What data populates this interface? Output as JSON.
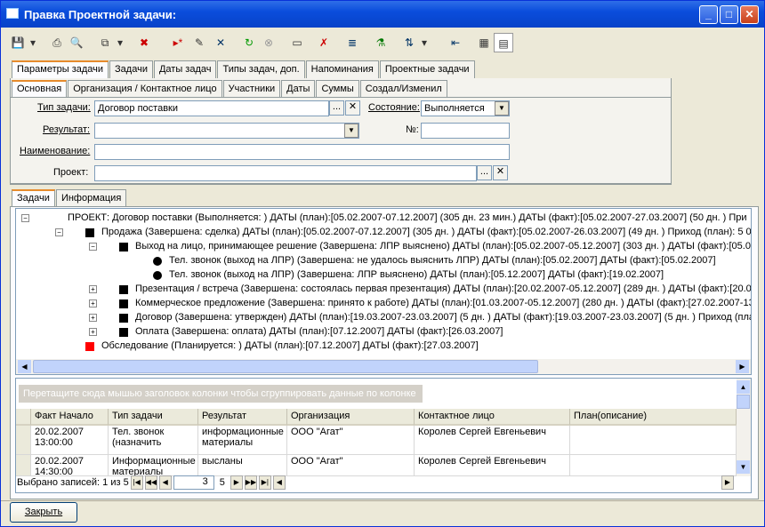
{
  "window": {
    "title": "Правка Проектной задачи:"
  },
  "top_tabs": [
    "Параметры задачи",
    "Задачи",
    "Даты задач",
    "Типы задач, доп.",
    "Напоминания",
    "Проектные задачи"
  ],
  "sub_tabs": [
    "Основная",
    "Организация / Контактное лицо",
    "Участники",
    "Даты",
    "Суммы",
    "Создал/Изменил"
  ],
  "form": {
    "task_type_label": "Тип задачи:",
    "task_type_value": "Договор поставки",
    "state_label": "Состояние:",
    "state_value": "Выполняется",
    "result_label": "Результат:",
    "result_value": "",
    "number_label": "№:",
    "number_value": "",
    "name_label": "Наименование:",
    "name_value": "",
    "project_label": "Проект:",
    "project_value": ""
  },
  "lower_tabs": [
    "Задачи",
    "Информация"
  ],
  "tree": [
    "ПРОЕКТ: Договор поставки (Выполняется: ) ДАТЫ (план):[05.02.2007-07.12.2007] (305 дн. 23 мин.)  ДАТЫ (факт):[05.02.2007-27.03.2007] (50 дн. )   При",
    "Продажа (Завершена: сделка) ДАТЫ (план):[05.02.2007-07.12.2007] (305 дн. )  ДАТЫ (факт):[05.02.2007-26.03.2007] (49 дн. )   Приход (план): 5 0",
    "Выход на лицо, принимающее решение (Завершена: ЛПР выяснено) ДАТЫ (план):[05.02.2007-05.12.2007] (303 дн. )  ДАТЫ (факт):[05.02",
    "Тел. звонок (выход на ЛПР) (Завершена: не удалось выяснить ЛПР) ДАТЫ (план):[05.02.2007] ДАТЫ (факт):[05.02.2007]",
    "Тел. звонок (выход на ЛПР) (Завершена: ЛПР выяснено) ДАТЫ (план):[05.12.2007] ДАТЫ (факт):[19.02.2007]",
    "Презентация / встреча (Завершена: состоялась первая презентация) ДАТЫ (план):[20.02.2007-05.12.2007] (289 дн. )  ДАТЫ (факт):[20.0",
    "Коммерческое предложение (Завершена: принято к работе) ДАТЫ (план):[01.03.2007-05.12.2007] (280 дн. )  ДАТЫ (факт):[27.02.2007-13",
    "Договор (Завершена: утвержден) ДАТЫ (план):[19.03.2007-23.03.2007] (5 дн. )  ДАТЫ (факт):[19.03.2007-23.03.2007] (5 дн. )   Приход (пла",
    "Оплата (Завершена: оплата) ДАТЫ (план):[07.12.2007] ДАТЫ (факт):[26.03.2007]",
    "Обследование (Планируется: ) ДАТЫ (план):[07.12.2007] ДАТЫ (факт):[27.03.2007]"
  ],
  "grid": {
    "group_hint": "Перетащите сюда мышью заголовок колонки чтобы сгруппировать данные по колонке",
    "columns": [
      "Факт Начало",
      "Тип задачи",
      "Результат",
      "Организация",
      "Контактное лицо",
      "План(описание)"
    ],
    "rows": [
      [
        "20.02.2007\n13:00:00",
        "Тел. звонок\n(назначить",
        "информационные\nматериалы",
        "ООО \"Агат\"",
        "Королев Сергей Евгеньевич",
        ""
      ],
      [
        "20.02.2007\n14:30:00",
        "Информационные\nматериалы",
        "высланы",
        "ООО \"Агат\"",
        "Королев Сергей Евгеньевич",
        ""
      ]
    ],
    "selected_text": "Выбрано записей: 1 из 5",
    "page_current": "3",
    "page_total": "5"
  },
  "footer": {
    "close_label": "Закрыть"
  }
}
